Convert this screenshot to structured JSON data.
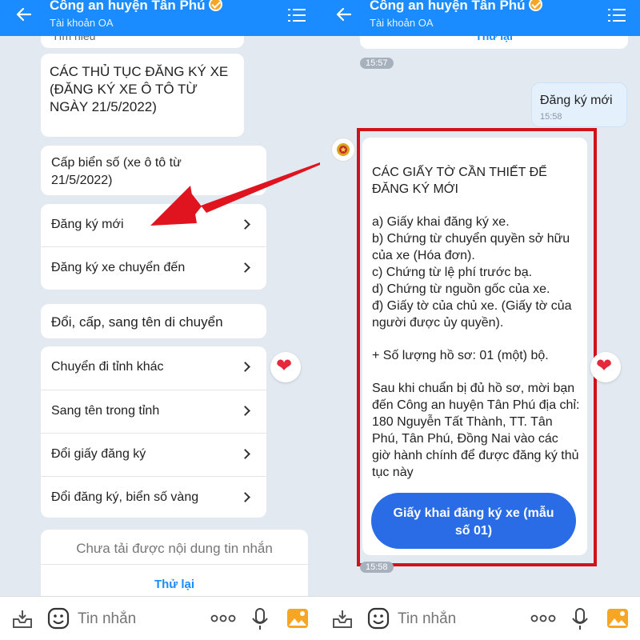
{
  "header": {
    "title": "Công an huyện Tân Phú",
    "subtitle": "Tài khoản OA"
  },
  "left": {
    "top_partial": "Tìm hiểu",
    "card_title": "CÁC THỦ TỤC ĐĂNG KÝ XE (ĐĂNG KÝ XE Ô TÔ TỪ NGÀY 21/5/2022)",
    "section1_title": "Cấp biển số (xe ô tô từ 21/5/2022)",
    "section1_items": [
      "Đăng ký mới",
      "Đăng ký xe chuyển đến"
    ],
    "section2_title": "Đổi, cấp, sang tên di chuyển",
    "section2_items": [
      "Chuyển đi tỉnh khác",
      "Sang tên trong tỉnh",
      "Đổi giấy đăng ký",
      "Đổi đăng ký, biển số vàng"
    ],
    "error_text": "Chưa tải được nội dung tin nhắn",
    "retry": "Thử lại"
  },
  "right": {
    "retry_partial": "Thử lại",
    "time1": "15:57",
    "user_message": "Đăng ký mới",
    "user_time": "15:58",
    "reply_title": "CÁC GIẤY TỜ CẦN THIẾT ĐỂ ĐĂNG KÝ MỚI",
    "reply_list": [
      "a) Giấy khai đăng ký xe.",
      "b) Chứng từ chuyển quyền sở hữu của xe (Hóa đơn).",
      "c) Chứng từ lệ phí trước bạ.",
      "d) Chứng từ nguồn gốc của xe.",
      "đ) Giấy tờ của chủ xe. (Giấy tờ của người được ủy quyền)."
    ],
    "reply_count": "+ Số lượng hồ sơ: 01 (một) bộ.",
    "reply_footer": "Sau khi chuẩn bị đủ hồ sơ, mời bạn đến Công an huyện Tân Phú địa chỉ: 180 Nguyễn Tất Thành, TT. Tân Phú, Tân Phú, Đồng Nai vào các giờ hành chính để được đăng ký thủ tục này",
    "button_label": "Giấy khai đăng ký xe (mẫu số 01)",
    "time2": "15:58"
  },
  "input": {
    "placeholder": "Tin nhắn"
  },
  "colors": {
    "header": "#1a8cff",
    "annotation_arrow": "#e0141e",
    "highlight_box": "#d0121b",
    "button": "#2a6be6"
  },
  "icons": [
    "back-arrow-icon",
    "verified-badge-icon",
    "menu-list-icon",
    "chevron-right-icon",
    "heart-icon",
    "police-avatar-icon",
    "inbox-icon",
    "emoji-icon",
    "more-dots-icon",
    "microphone-icon",
    "image-icon"
  ]
}
